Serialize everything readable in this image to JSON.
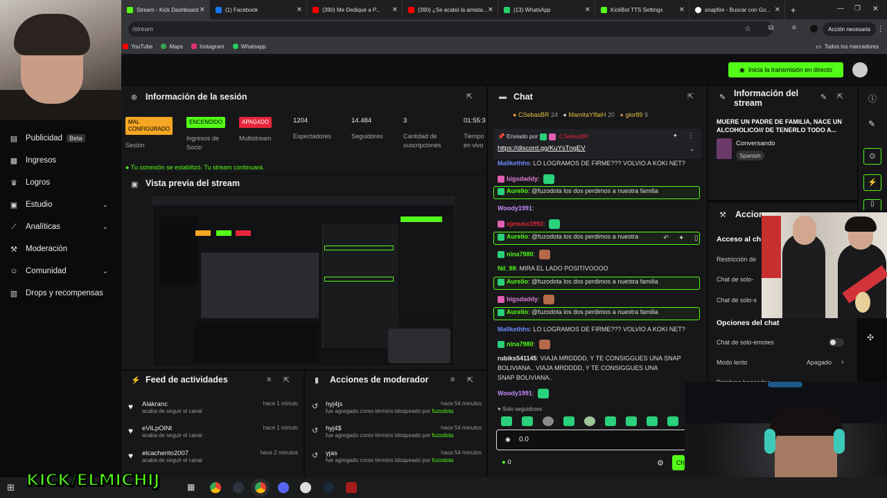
{
  "browser": {
    "tabs": [
      {
        "label": "Stream - Kick Dashboard",
        "color": "#53fc18",
        "active": true
      },
      {
        "label": "(1) Facebook",
        "color": "#1877f2"
      },
      {
        "label": "(390) Me Dediqué a P...",
        "color": "#ff0000"
      },
      {
        "label": "(390) ¿Se acabó la amista...",
        "color": "#ff0000"
      },
      {
        "label": "(13) WhatsApp",
        "color": "#25d366"
      },
      {
        "label": "KickBot TTS Settings",
        "color": "#53fc18"
      },
      {
        "label": "snapfire - Buscar con Go...",
        "color": "#ffffff"
      }
    ],
    "new_tab": "+",
    "address": "/stream",
    "accion": "Acción necesaria",
    "bookmarks": [
      {
        "label": "YouTube",
        "color": "#ff0000"
      },
      {
        "label": "Maps",
        "color": "#34a853"
      },
      {
        "label": "Instagram",
        "color": "#e1306c"
      },
      {
        "label": "Whatsapp",
        "color": "#25d366"
      }
    ],
    "all_bookmarks": "Todos los marcadores"
  },
  "topbar": {
    "live_button": "Inicia la transmisión en directo"
  },
  "sidebar": {
    "items": [
      {
        "label": "Publicidad",
        "badge": "Beta",
        "icon": "ad-icon"
      },
      {
        "label": "Ingresos",
        "icon": "revenue-icon"
      },
      {
        "label": "Logros",
        "icon": "trophy-icon"
      },
      {
        "label": "Estudio",
        "icon": "studio-icon",
        "chevron": true
      },
      {
        "label": "Analíticas",
        "icon": "analytics-icon",
        "chevron": true
      },
      {
        "label": "Moderación",
        "icon": "moderation-icon"
      },
      {
        "label": "Comunidad",
        "icon": "community-icon",
        "chevron": true
      },
      {
        "label": "Drops y recompensas",
        "icon": "drops-icon"
      }
    ]
  },
  "session": {
    "title": "Información de la sesión",
    "stats": [
      {
        "value": "MAL CONFIGURADO",
        "label": "Sesión",
        "status_color": "#f5a623"
      },
      {
        "value": "ENCENDIDO",
        "label": "Ingresos de Socio",
        "status_color": "#53fc18"
      },
      {
        "value": "APAGADO",
        "label": "Multistream",
        "status_color": "#e5263a"
      },
      {
        "value": "1204",
        "label": "Espectadores"
      },
      {
        "value": "14.484",
        "label": "Seguidores"
      },
      {
        "value": "3",
        "label": "Cantidad de suscripciones"
      },
      {
        "value": "01:55:3",
        "label": "Tiempo en vivo"
      }
    ],
    "connection_msg": "Tu conexión se estabilizó. Tu stream continuará."
  },
  "preview": {
    "title": "Vista previa del stream"
  },
  "feed": {
    "title": "Feed de actividades",
    "rows": [
      {
        "user": "Alakranc",
        "action": "acaba de seguir el canal",
        "time": "hace 1 minuto"
      },
      {
        "user": "eViLpOiNt",
        "action": "acaba de seguir el canal",
        "time": "hace 1 minuto"
      },
      {
        "user": "elcacherito2007",
        "action": "acaba de seguir el canal",
        "time": "hace 2 minutos"
      }
    ]
  },
  "modactions": {
    "title": "Acciones de moderador",
    "rows": [
      {
        "term": "hyj4js",
        "action": "fue agregado como término bloqueado por",
        "by": "fuzodota",
        "time": "hace 54 minutos"
      },
      {
        "term": "hyj4$",
        "action": "fue agregado como término bloqueado por",
        "by": "fuzodota",
        "time": "hace 54 minutos"
      },
      {
        "term": "yjas",
        "action": "fue agregado como término bloqueado por",
        "by": "fuzodota",
        "time": "hace 54 minutos"
      }
    ]
  },
  "chat": {
    "title": "Chat",
    "leaderboard": [
      {
        "name": "CSebasBR",
        "count": "24"
      },
      {
        "name": "MamitaYIfaiH",
        "count": "20"
      },
      {
        "name": "gior89",
        "count": "9"
      }
    ],
    "pinned": {
      "sent_by": "Enviado por",
      "sender": "CSebasBR",
      "link": "https://discord.gg/KuYsTngEV"
    },
    "messages": [
      {
        "user": "Mallkethhs",
        "text": "LO LOGRAMOS DE FIRME??? VOLVIO A KOKI NET?",
        "ucolor": "#6c8cff"
      },
      {
        "user": "bigsdaddy",
        "text": "",
        "ucolor": "#e07bd8",
        "emote": true
      },
      {
        "user": "Aurelio",
        "text": "@fuzodota los dos perdimos a nuestra familia",
        "ucolor": "#53fc18",
        "highlight": true
      },
      {
        "user": "Woody1991",
        "text": "",
        "ucolor": "#c58cff"
      },
      {
        "user": "xjesusx1992",
        "text": "",
        "ucolor": "#e5263a",
        "emote": true
      },
      {
        "user": "Aurelio",
        "text": "@fuzodota los dos perdimos a nuestra",
        "ucolor": "#53fc18",
        "highlight": true
      },
      {
        "user": "nina7980",
        "text": "",
        "ucolor": "#53fc18",
        "emote": true
      },
      {
        "user": "Nil_98",
        "text": "MIRA EL LADO POSITIVOOOO",
        "ucolor": "#53fc18"
      },
      {
        "user": "Aurelio",
        "text": "@fuzodota los dos perdimos a nuestra familia",
        "ucolor": "#53fc18",
        "highlight": true
      },
      {
        "user": "bigsdaddy",
        "text": "",
        "ucolor": "#e07bd8",
        "emote": true
      },
      {
        "user": "Aurelio",
        "text": "@fuzodota los dos perdimos a nuestra familia",
        "ucolor": "#53fc18",
        "highlight": true
      },
      {
        "user": "Mallkethhs",
        "text": "LO LOGRAMOS DE FIRME??? VOLVIO A KOKI NET?",
        "ucolor": "#6c8cff"
      },
      {
        "user": "nina7980",
        "text": "",
        "ucolor": "#53fc18",
        "emote": true
      },
      {
        "user": "rubiks541145",
        "text": "VIAJA MRDDDD, Y TE CONSIGGUES UNA SNAP",
        "ucolor": "#eeeeee"
      },
      {
        "user": "",
        "text": "BOLIVIANA..  VIAJA MRDDDD, Y TE CONSIGGUES UNA",
        "ucolor": "#eeeeee"
      },
      {
        "user": "",
        "text": "SNAP BOLIVIANA..",
        "ucolor": "#eeeeee"
      },
      {
        "user": "Woody1991",
        "text": "",
        "ucolor": "#c58cff",
        "emote": true
      }
    ],
    "followers_only": "Solo seguidores",
    "input_value": "0.0",
    "points": "0",
    "send": "Chat"
  },
  "stream_info": {
    "title": "Información del stream",
    "stream_title": "MUERE UN PADRE DE FAMILIA, NACE UN ALCOHOLICO/// DE TENERLO TODO A...",
    "category": "Conversando",
    "language": "Spanish"
  },
  "actions": {
    "title": "Acciones",
    "quick_access": "Acceso al ch",
    "restriction": "Restricción de",
    "solo_1": "Chat de solo-",
    "solo_2": "Chat de solo-s",
    "chat_options_title": "Opciones del chat",
    "emotes_only": "Chat de solo-emotes",
    "slow_mode": "Modo lento",
    "slow_mode_value": "Apagado",
    "banned_words": "Palabras baneadas"
  },
  "watermark": "KICK/ELMICHIJ"
}
